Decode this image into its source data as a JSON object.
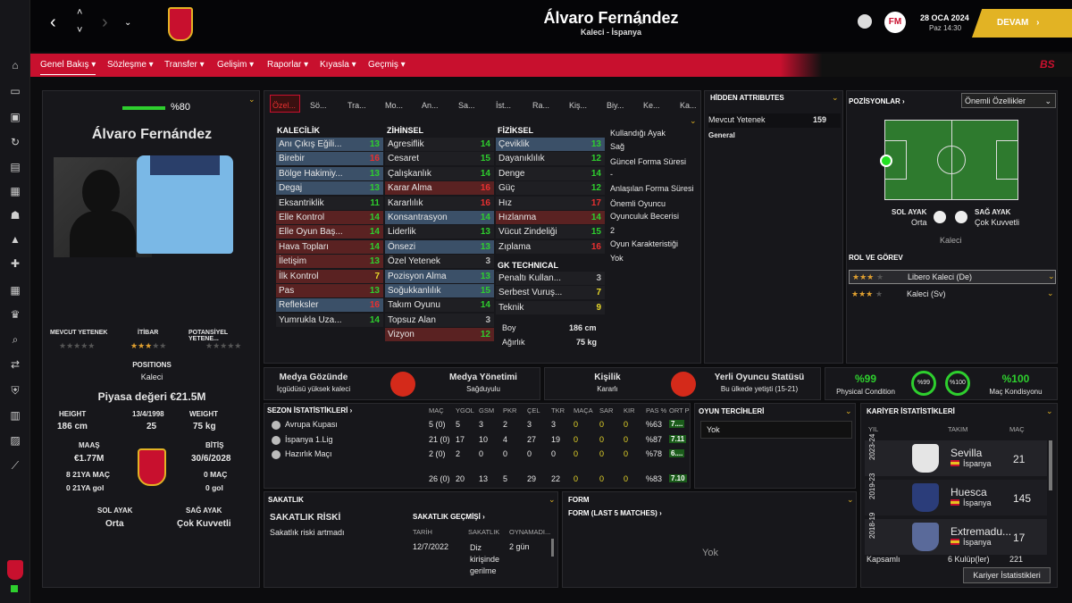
{
  "header": {
    "title": "Álvaro Fernández",
    "subtitle": "Kaleci - İspanya",
    "date": "28 OCA 2024",
    "time": "Paz 14:30",
    "continue": "DEVAM",
    "fm": "FM"
  },
  "menu": [
    "Genel Bakış",
    "Sözleşme",
    "Transfer",
    "Gelişim",
    "Raporlar",
    "Kıyasla",
    "Geçmiş"
  ],
  "menu_right": "BS",
  "profile": {
    "condition": "%80",
    "name": "Álvaro Fernández",
    "ability_labels": [
      "MEVCUT YETENEK",
      "İTİBAR",
      "POTANSİYEL YETENE..."
    ],
    "positions_label": "POSITIONS",
    "position": "Kaleci",
    "value": "Piyasa değeri €21.5M",
    "height_label": "HEIGHT",
    "height": "186 cm",
    "dob": "13/4/1998",
    "age": "25",
    "weight_label": "WEIGHT",
    "weight": "75 kg",
    "wage_label": "MAAŞ",
    "wage": "€1.77M",
    "end_label": "BİTİŞ",
    "end": "30/6/2028",
    "u21_caps": "8 21YA MAÇ",
    "u21_goals": "0 21YA gol",
    "caps": "0 MAÇ",
    "goals": "0 gol",
    "left_foot_label": "SOL AYAK",
    "left_foot": "Orta",
    "right_foot_label": "SAĞ AYAK",
    "right_foot": "Çok Kuvvetli"
  },
  "tabs": [
    "Özel...",
    "Sö...",
    "Tra...",
    "Mo...",
    "An...",
    "Sa...",
    "İst...",
    "Ra...",
    "Kiş...",
    "Biy...",
    "Ke...",
    "Ka..."
  ],
  "goalkeeping": {
    "title": "KALECİLİK",
    "rows": [
      [
        "Anı Çıkış Eğili...",
        "13"
      ],
      [
        "Birebir",
        "16"
      ],
      [
        "Bölge Hakimiy...",
        "13"
      ],
      [
        "Degaj",
        "13"
      ],
      [
        "Eksantriklik",
        "11"
      ],
      [
        "Elle Kontrol",
        "14"
      ],
      [
        "Elle Oyun Baş...",
        "14"
      ],
      [
        "Hava Topları",
        "14"
      ],
      [
        "İletişim",
        "13"
      ],
      [
        "İlk Kontrol",
        "7"
      ],
      [
        "Pas",
        "13"
      ],
      [
        "Refleksler",
        "16"
      ],
      [
        "Yumrukla Uza...",
        "14"
      ]
    ]
  },
  "mental": {
    "title": "ZİHİNSEL",
    "rows": [
      [
        "Agresiflik",
        "14"
      ],
      [
        "Cesaret",
        "15"
      ],
      [
        "Çalışkanlık",
        "14"
      ],
      [
        "Karar Alma",
        "16"
      ],
      [
        "Kararlılık",
        "16"
      ],
      [
        "Konsantrasyon",
        "14"
      ],
      [
        "Liderlik",
        "13"
      ],
      [
        "Önsezi",
        "13"
      ],
      [
        "Özel Yetenek",
        "3"
      ],
      [
        "Pozisyon Alma",
        "13"
      ],
      [
        "Soğukkanlılık",
        "15"
      ],
      [
        "Takım Oyunu",
        "14"
      ],
      [
        "Topsuz Alan",
        "3"
      ],
      [
        "Vizyon",
        "12"
      ]
    ]
  },
  "physical": {
    "title": "FİZİKSEL",
    "rows": [
      [
        "Çeviklik",
        "13"
      ],
      [
        "Dayanıklılık",
        "12"
      ],
      [
        "Denge",
        "14"
      ],
      [
        "Güç",
        "12"
      ],
      [
        "Hız",
        "17"
      ],
      [
        "Hızlanma",
        "14"
      ],
      [
        "Vücut Zindeliği",
        "15"
      ],
      [
        "Zıplama",
        "16"
      ]
    ]
  },
  "gk_tech": {
    "title": "GK TECHNICAL",
    "rows": [
      [
        "Penaltı Kullan...",
        "3"
      ],
      [
        "Serbest Vuruş...",
        "7"
      ],
      [
        "Teknik",
        "9"
      ]
    ]
  },
  "bio": {
    "height_label": "Boy",
    "height": "186 cm",
    "weight_label": "Ağırlık",
    "weight": "75 kg"
  },
  "info_list": [
    "Kullandığı Ayak",
    "Sağ",
    "Güncel Forma Süresi",
    "-",
    "Anlaşılan Forma Süresi",
    "Önemli Oyuncu",
    "Oyunculuk Becerisi",
    "2",
    "Oyun Karakteristiği",
    "Yok"
  ],
  "hidden": {
    "title": "HİDDEN ATTRIBUTES",
    "ca_label": "Mevcut Yetenek",
    "ca": "159",
    "general": "General"
  },
  "positions": {
    "title": "POZİSYONLAR",
    "dropdown": "Önemli Özellikler",
    "left_foot_label": "SOL AYAK",
    "left_foot": "Orta",
    "right_foot_label": "SAĞ AYAK",
    "right_foot": "Çok Kuvvetli",
    "role_pos": "Kaleci",
    "role_title": "ROL VE GÖREV",
    "roles": [
      "Libero Kaleci (De)",
      "Kaleci (Sv)"
    ]
  },
  "cards": {
    "media_title": "Medya Gözünde",
    "media_sub": "İçgüdüsü yüksek kaleci",
    "media_mgmt": "Medya Yönetimi",
    "media_mgmt_sub": "Sağduyulu",
    "personality": "Kişilik",
    "personality_sub": "Kararlı",
    "homegrown": "Yerli Oyuncu Statüsü",
    "homegrown_sub": "Bu ülkede yetişti (15-21)",
    "phys": "%99",
    "phys_label": "Physical Condition",
    "ring1": "%99",
    "ring2": "%100",
    "match": "%100",
    "match_label": "Maç Kondisyonu"
  },
  "season": {
    "title": "SEZON İSTATİSTİKLERİ",
    "cols": [
      "MAÇ",
      "YGOL",
      "GSM",
      "PKR",
      "ÇEL",
      "TKR",
      "MAÇA",
      "SAR",
      "KIR",
      "PAS %",
      "ORT P"
    ],
    "rows": [
      {
        "name": "Avrupa Kupası",
        "vals": [
          "5 (0)",
          "5",
          "3",
          "2",
          "3",
          "3",
          "0",
          "0",
          "0",
          "%63",
          "7...."
        ]
      },
      {
        "name": "İspanya 1.Lig",
        "vals": [
          "21 (0)",
          "17",
          "10",
          "4",
          "27",
          "19",
          "0",
          "0",
          "0",
          "%87",
          "7.11"
        ]
      },
      {
        "name": "Hazırlık Maçı",
        "vals": [
          "2 (0)",
          "2",
          "0",
          "0",
          "0",
          "0",
          "0",
          "0",
          "0",
          "%78",
          "6...."
        ]
      }
    ],
    "total": [
      "26 (0)",
      "20",
      "13",
      "5",
      "29",
      "22",
      "0",
      "0",
      "0",
      "%83",
      "7.10"
    ]
  },
  "pref": {
    "title": "OYUN TERCİHLERİ",
    "value": "Yok"
  },
  "career": {
    "title": "KARİYER İSTATİSTİKLERİ",
    "cols": [
      "YIL",
      "TAKIM",
      "MAÇ"
    ],
    "rows": [
      {
        "year": "2023-24",
        "team": "Sevilla",
        "nation": "İspanya",
        "apps": "21"
      },
      {
        "year": "2019-23",
        "team": "Huesca",
        "nation": "İspanya",
        "apps": "145"
      },
      {
        "year": "2018-19",
        "team": "Extremadu...",
        "nation": "İspanya",
        "apps": "17"
      }
    ],
    "total_label": "Kapsamlı",
    "total_clubs": "6 Kulüp(ler)",
    "total_apps": "221",
    "button": "Kariyer İstatistikleri"
  },
  "injury": {
    "title": "SAKATLIK",
    "risk_title": "SAKATLIK RİSKİ",
    "risk": "Sakatlık riski artmadı",
    "history": "SAKATLIK GEÇMİŞİ",
    "cols": [
      "TARİH",
      "SAKATLIK",
      "OYNAMADI..."
    ],
    "date": "12/7/2022",
    "injury": "Diz kirişinde gerilme",
    "out": "2 gün"
  },
  "form": {
    "title": "FORM",
    "sub": "FORM (LAST 5 MATCHES)",
    "value": "Yok"
  },
  "colors": {
    "accent": "#c8102e",
    "gold": "#e2b324",
    "green": "#2ecf2e",
    "red": "#e83030",
    "yellow": "#e8d82a"
  }
}
